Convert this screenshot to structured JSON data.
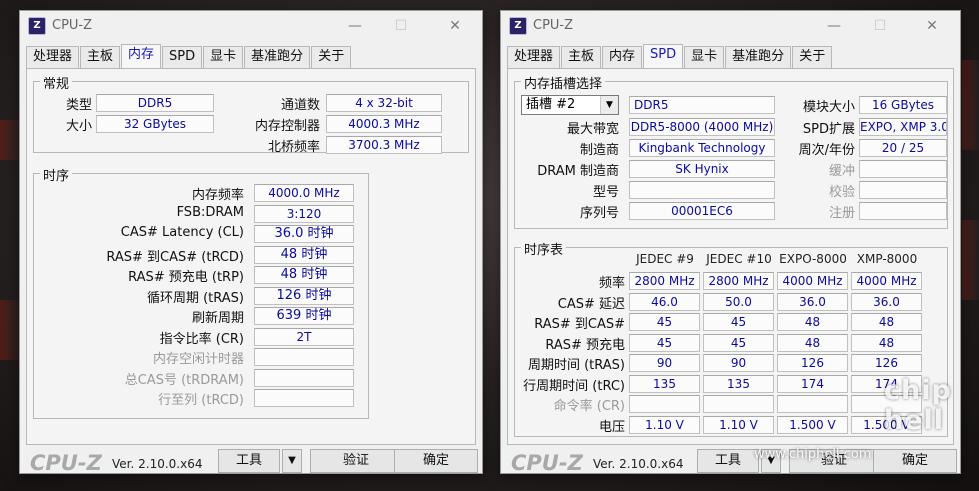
{
  "app_title": "CPU-Z",
  "tabs": [
    "处理器",
    "主板",
    "内存",
    "SPD",
    "显卡",
    "基准跑分",
    "关于"
  ],
  "memory_tab": {
    "general": {
      "title": "常规",
      "type_label": "类型",
      "type_value": "DDR5",
      "size_label": "大小",
      "size_value": "32 GBytes",
      "channels_label": "通道数",
      "channels_value": "4 x 32-bit",
      "mc_label": "内存控制器",
      "mc_value": "4000.3 MHz",
      "nb_label": "北桥频率",
      "nb_value": "3700.3 MHz"
    },
    "timings": {
      "title": "时序",
      "rows": [
        {
          "label": "内存频率",
          "value": "4000.0 MHz",
          "dim": false
        },
        {
          "label": "FSB:DRAM",
          "value": "3:120",
          "dim": false
        },
        {
          "label": "CAS# Latency (CL)",
          "value": "36.0 时钟",
          "dim": false
        },
        {
          "label": "RAS# 到CAS# (tRCD)",
          "value": "48 时钟",
          "dim": false
        },
        {
          "label": "RAS# 预充电 (tRP)",
          "value": "48 时钟",
          "dim": false
        },
        {
          "label": "循环周期 (tRAS)",
          "value": "126 时钟",
          "dim": false
        },
        {
          "label": "刷新周期",
          "value": "639 时钟",
          "dim": false
        },
        {
          "label": "指令比率 (CR)",
          "value": "2T",
          "dim": false
        },
        {
          "label": "内存空闲计时器",
          "value": "",
          "dim": true
        },
        {
          "label": "总CAS号 (tRDRAM)",
          "value": "",
          "dim": true
        },
        {
          "label": "行至列 (tRCD)",
          "value": "",
          "dim": true
        }
      ]
    }
  },
  "spd_tab": {
    "slot_group_title": "内存插槽选择",
    "slot_selected": "插槽 #2",
    "module_type": "DDR5",
    "max_bw_label": "最大带宽",
    "max_bw_value": "DDR5-8000 (4000 MHz)",
    "mfr_label": "制造商",
    "mfr_value": "Kingbank Technology",
    "dram_mfr_label": "DRAM 制造商",
    "dram_mfr_value": "SK Hynix",
    "part_label": "型号",
    "part_value": "",
    "serial_label": "序列号",
    "serial_value": "00001EC6",
    "module_size_label": "模块大小",
    "module_size_value": "16 GBytes",
    "spd_ext_label": "SPD扩展",
    "spd_ext_value": "EXPO, XMP 3.0",
    "week_year_label": "周次/年份",
    "week_year_value": "20 / 25",
    "buffer_label": "缓冲",
    "buffer_value": "",
    "correction_label": "校验",
    "correction_value": "",
    "registered_label": "注册",
    "registered_value": "",
    "timing_table": {
      "title": "时序表",
      "columns": [
        "JEDEC #9",
        "JEDEC #10",
        "EXPO-8000",
        "XMP-8000"
      ],
      "rows": [
        {
          "label": "频率",
          "values": [
            "2800 MHz",
            "2800 MHz",
            "4000 MHz",
            "4000 MHz"
          ],
          "dim": false
        },
        {
          "label": "CAS# 延迟",
          "values": [
            "46.0",
            "50.0",
            "36.0",
            "36.0"
          ],
          "dim": false
        },
        {
          "label": "RAS# 到CAS#",
          "values": [
            "45",
            "45",
            "48",
            "48"
          ],
          "dim": false
        },
        {
          "label": "RAS# 预充电",
          "values": [
            "45",
            "45",
            "48",
            "48"
          ],
          "dim": false
        },
        {
          "label": "周期时间 (tRAS)",
          "values": [
            "90",
            "90",
            "126",
            "126"
          ],
          "dim": false
        },
        {
          "label": "行周期时间 (tRC)",
          "values": [
            "135",
            "135",
            "174",
            "174"
          ],
          "dim": false
        },
        {
          "label": "命令率 (CR)",
          "values": [
            "",
            "",
            "",
            ""
          ],
          "dim": true
        },
        {
          "label": "电压",
          "values": [
            "1.10 V",
            "1.10 V",
            "1.500 V",
            "1.500 V"
          ],
          "dim": false
        }
      ]
    }
  },
  "footer": {
    "logo": "CPU-Z",
    "version": "Ver. 2.10.0.x64",
    "tools_label": "工具",
    "validate_label": "验证",
    "ok_label": "确定"
  },
  "watermark": {
    "url": "www.chiphell.com",
    "logo_text": "chip hell"
  }
}
